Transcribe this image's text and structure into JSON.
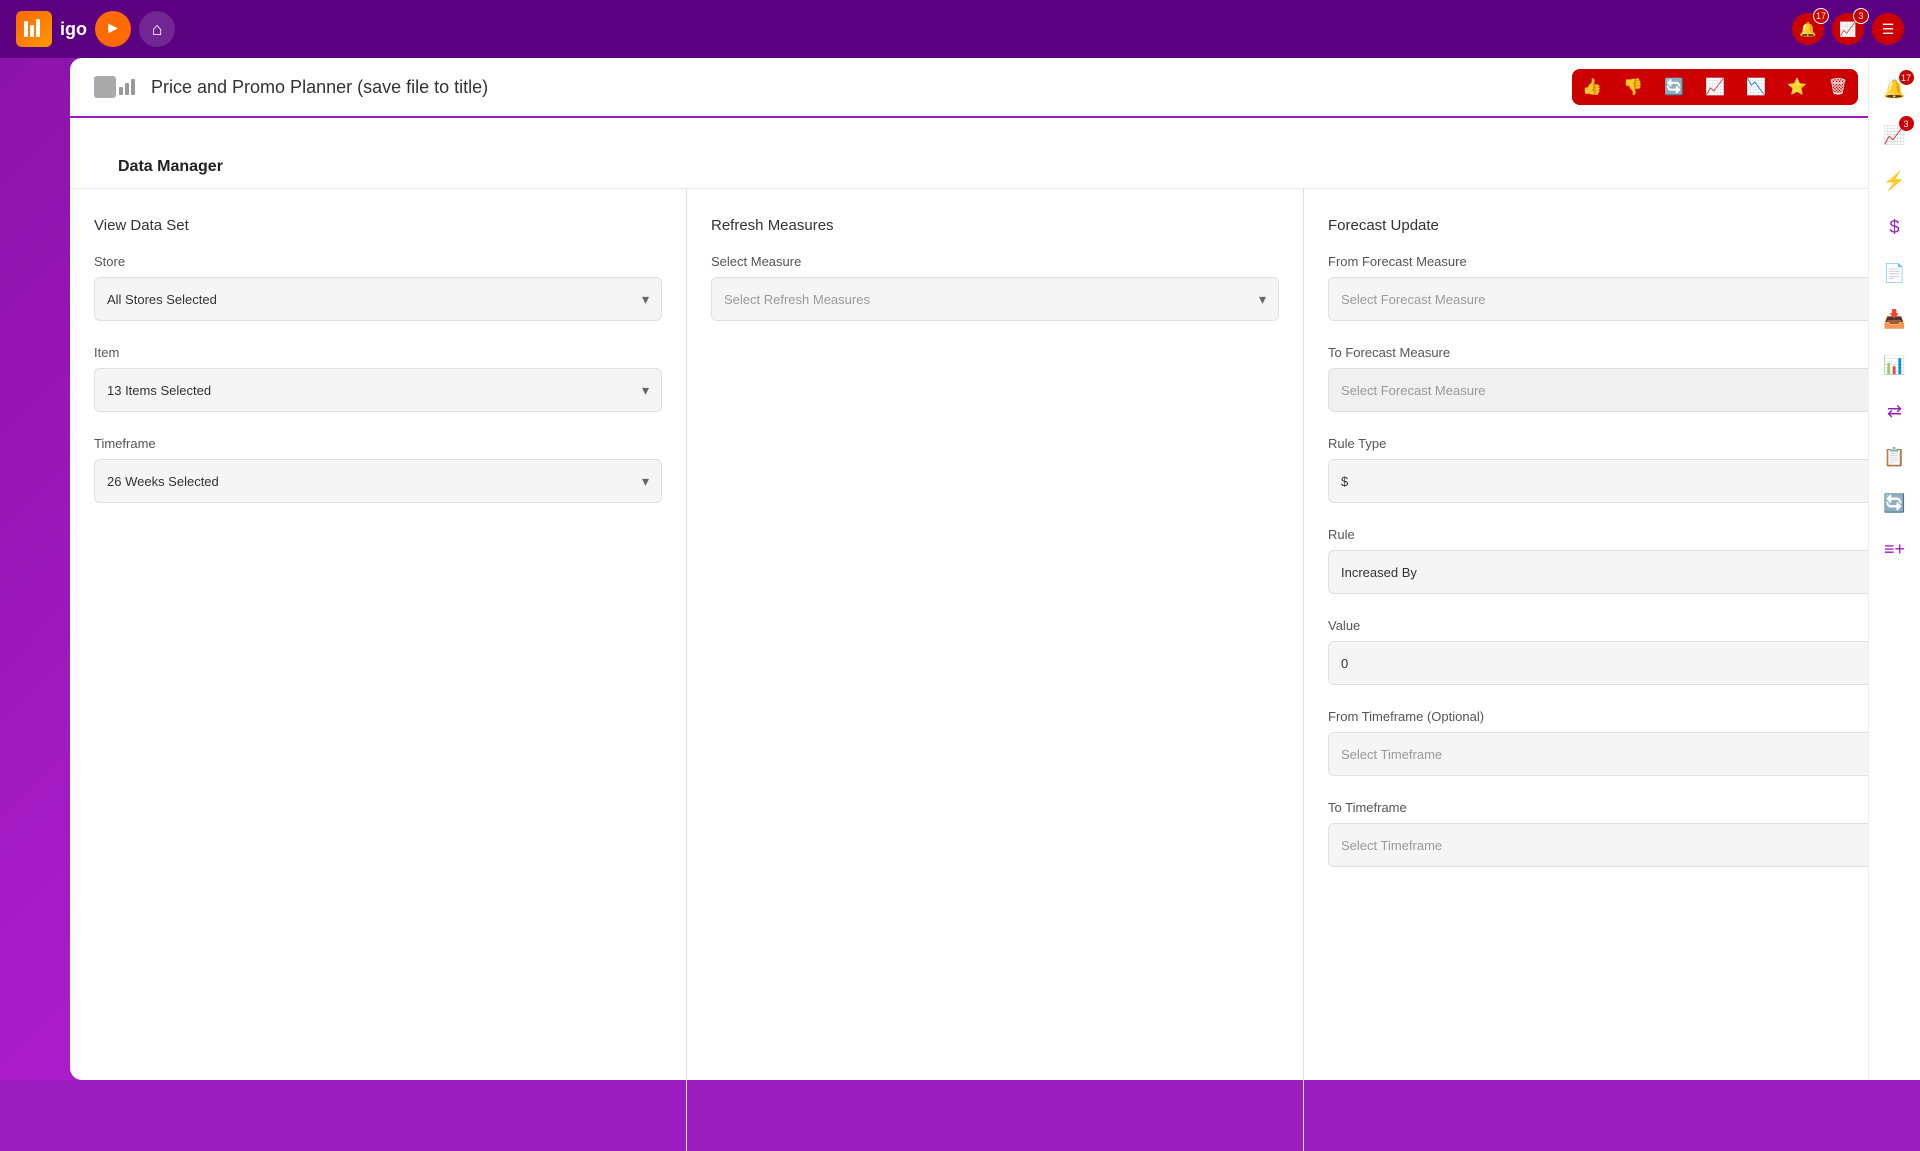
{
  "app": {
    "logo_text": "igo",
    "title": "Price and Promo Planner (save file to title)"
  },
  "toolbar": {
    "buttons": [
      "👍",
      "👎",
      "🔄",
      "📈",
      "📉",
      "⭐",
      "🗑"
    ]
  },
  "page": {
    "title": "Data Manager"
  },
  "view_data_set": {
    "section_title": "View Data Set",
    "store_label": "Store",
    "store_value": "All Stores Selected",
    "item_label": "Item",
    "item_value": "13 Items Selected",
    "timeframe_label": "Timeframe",
    "timeframe_value": "26 Weeks Selected"
  },
  "refresh_measures": {
    "section_title": "Refresh Measures",
    "select_measure_label": "Select Measure",
    "select_measure_placeholder": "Select Refresh Measures"
  },
  "forecast_update": {
    "section_title": "Forecast Update",
    "from_forecast_label": "From Forecast Measure",
    "from_forecast_placeholder": "Select Forecast Measure",
    "to_forecast_label": "To Forecast Measure",
    "to_forecast_placeholder": "Select Forecast Measure",
    "rule_type_label": "Rule Type",
    "rule_type_value": "$",
    "rule_label": "Rule",
    "rule_value": "Increased By",
    "value_label": "Value",
    "value_value": "0",
    "from_timeframe_label": "From Timeframe (Optional)",
    "from_timeframe_placeholder": "Select Timeframe",
    "to_timeframe_label": "To Timeframe",
    "to_timeframe_placeholder": "Select Timeframe"
  },
  "right_sidebar": {
    "icons": [
      "🔔",
      "⚡",
      "$",
      "📄",
      "📥",
      "📊",
      "⇄",
      "📋",
      "🔄",
      "≡+"
    ],
    "notification_badge": "17",
    "analytics_badge": "3"
  }
}
